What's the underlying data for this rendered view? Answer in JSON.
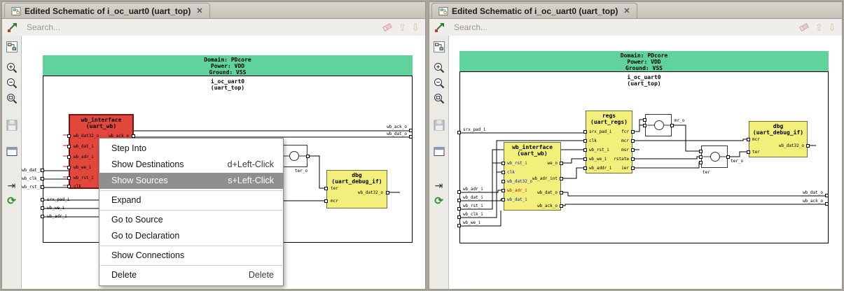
{
  "colors": {
    "header_green": "#5fd39b",
    "selected_block_red": "#e2473d",
    "block_yellow": "#f3ef7b",
    "menu_highlight_gray": "#8f8f8f",
    "port_blue_text": "#1414c8",
    "port_red_text": "#c01414"
  },
  "tab": {
    "title": "Edited Schematic of i_oc_uart0 (uart_top)",
    "close": "✕"
  },
  "toolbar": {
    "search_placeholder": "Search...",
    "icons": [
      "signal-trace",
      "eraser",
      "search-previous",
      "search-next"
    ],
    "arrow_up": "⇧",
    "arrow_down": "⇩"
  },
  "strip_icons": [
    "schematic",
    "zoom-in",
    "zoom-out",
    "zoom-fit",
    "save",
    "window",
    "trace",
    "reload"
  ],
  "strip_glyphs": {
    "trace": "⇥",
    "reload": "⟳"
  },
  "header": {
    "domain": "Domain: PDcore",
    "power": "Power: VDD",
    "ground": "Ground: VSS",
    "instance": "i_oc_uart0",
    "module": "(uart_top)"
  },
  "left_view": {
    "block_wb": {
      "name": "wb_interface",
      "module": "(uart_wb)",
      "ports_left": [
        "wb_dat32_o",
        "wb_dat_i",
        "wb_adr_i",
        "wb_we_i",
        "wb_rst_i",
        "clk"
      ],
      "ports_right": [
        "wb_ack_o"
      ]
    },
    "block_dbg": {
      "name": "dbg",
      "module": "(uart_debug_if)",
      "ports_left": [
        "ter",
        "mcr"
      ],
      "ports_right": [
        "wb_dat32_o"
      ]
    },
    "buffer_out_label": "ter_o",
    "pins_left_outer": [
      "wb_dat_i",
      "wb_clk_i",
      "wb_rst_i"
    ],
    "pins_left_inner": [
      "srx_pad_i",
      "wb_we_i",
      "wb_adr_i"
    ],
    "pins_right": [
      "wb_ack_o",
      "wb_dat_o"
    ]
  },
  "menu": {
    "items": [
      {
        "label": "Step Into",
        "shortcut": ""
      },
      {
        "label": "Show Destinations",
        "shortcut": "d+Left-Click"
      },
      {
        "label": "Show Sources",
        "shortcut": "s+Left-Click"
      },
      {
        "label": "Expand",
        "shortcut": ""
      },
      {
        "label": "Go to Source",
        "shortcut": ""
      },
      {
        "label": "Go to Declaration",
        "shortcut": ""
      },
      {
        "label": "Show Connections",
        "shortcut": ""
      },
      {
        "label": "Delete",
        "shortcut": "Delete"
      }
    ]
  },
  "right_view": {
    "block_regs": {
      "name": "regs",
      "module": "(uart_regs)",
      "ports_left": [
        "srx_pad_i",
        "clk",
        "wb_rst_i",
        "wb_we_i",
        "wb_addr_i"
      ],
      "ports_right": [
        "fcr",
        "mcr",
        "msr",
        "rstate",
        "ier"
      ]
    },
    "block_wb": {
      "name": "wb_interface",
      "module": "(uart_wb)",
      "ports_left": [
        "wb_rst_i",
        "clk",
        "wb_dat32_o",
        "wb_adr_i",
        "wb_dat_i"
      ],
      "ports_right": [
        "we_o",
        "wb_adr_int",
        "wb_dat_o",
        "wb_ack_o"
      ]
    },
    "block_dbg": {
      "name": "dbg",
      "module": "(uart_debug_if)",
      "ports_left": [
        "mcr",
        "ter"
      ],
      "ports_right": [
        "wb_dat32_o"
      ]
    },
    "buffer1_label": "mr_o",
    "buffer2_label": "ter_o",
    "buffer2_sub": "ter",
    "pins_left": [
      "srx_pad_i",
      "wb_adr_i",
      "wb_dat_i",
      "wb_rst_i",
      "wb_clk_i",
      "wb_we_i"
    ],
    "pins_right": [
      "wb_dat_o",
      "wb_ack_o"
    ]
  }
}
